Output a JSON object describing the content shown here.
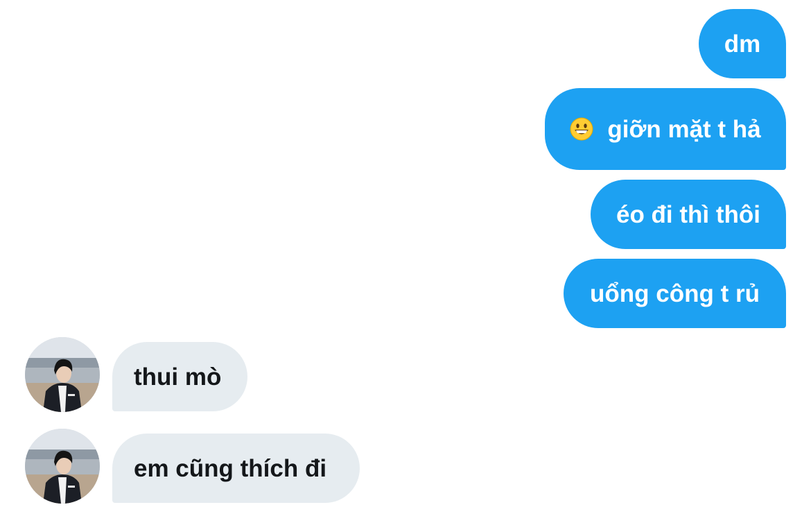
{
  "conversation": {
    "outgoing": [
      {
        "text": "dm"
      },
      {
        "text": "giỡn mặt t hả",
        "emoji": "grinning-face-icon"
      },
      {
        "text": "éo đi thì thôi"
      },
      {
        "text": "uổng công t rủ"
      }
    ],
    "incoming": [
      {
        "text": "thui mò",
        "avatar": "user-photo"
      },
      {
        "text": "em cũng thích đi",
        "avatar": "user-photo"
      }
    ]
  },
  "colors": {
    "outgoing_bubble": "#1da1f2",
    "outgoing_text": "#ffffff",
    "incoming_bubble": "#e6ecf0",
    "incoming_text": "#14171a",
    "background": "#ffffff"
  }
}
